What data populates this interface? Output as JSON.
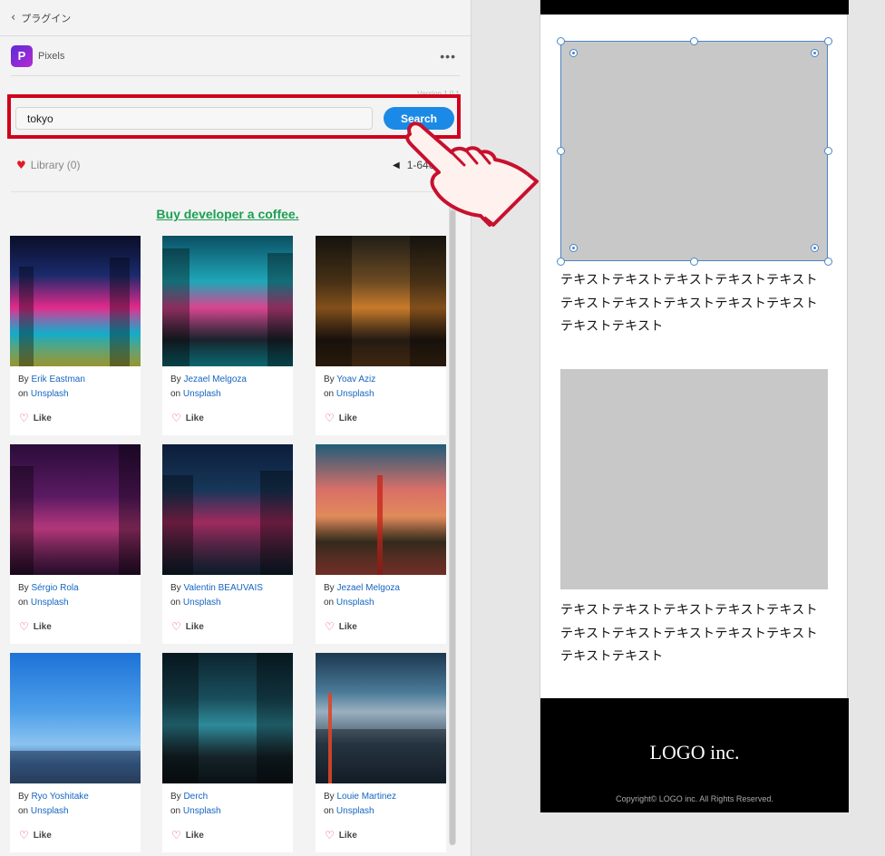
{
  "panel": {
    "breadcrumb": "プラグイン",
    "plugin_name": "Pixels",
    "plugin_logo_letter": "P",
    "version": "Version 1.0.1",
    "search": {
      "value": "tokyo",
      "button": "Search"
    },
    "library": "Library (0)",
    "pagination": "1-640",
    "coffee": "Buy developer a coffee.",
    "photos": [
      {
        "by": "By",
        "author": "Erik Eastman",
        "on": "on",
        "source": "Unsplash",
        "like": "Like"
      },
      {
        "by": "By",
        "author": "Jezael Melgoza",
        "on": "on",
        "source": "Unsplash",
        "like": "Like"
      },
      {
        "by": "By",
        "author": "Yoav Aziz",
        "on": "on",
        "source": "Unsplash",
        "like": "Like"
      },
      {
        "by": "By",
        "author": "Sérgio Rola",
        "on": "on",
        "source": "Unsplash",
        "like": "Like"
      },
      {
        "by": "By",
        "author": "Valentin BEAUVAIS",
        "on": "on",
        "source": "Unsplash",
        "like": "Like"
      },
      {
        "by": "By",
        "author": "Jezael Melgoza",
        "on": "on",
        "source": "Unsplash",
        "like": "Like"
      },
      {
        "by": "By",
        "author": "Ryo Yoshitake",
        "on": "on",
        "source": "Unsplash",
        "like": "Like"
      },
      {
        "by": "By",
        "author": "Derch",
        "on": "on",
        "source": "Unsplash",
        "like": "Like"
      },
      {
        "by": "By",
        "author": "Louie Martinez",
        "on": "on",
        "source": "Unsplash",
        "like": "Like"
      }
    ]
  },
  "artboard": {
    "text1_lines": [
      "テキストテキストテキストテキストテキスト",
      "テキストテキストテキストテキストテキスト",
      "テキストテキスト"
    ],
    "text2_lines": [
      "テキストテキストテキストテキストテキスト",
      "テキストテキストテキストテキストテキスト",
      "テキストテキスト"
    ],
    "footer_logo": "LOGO inc.",
    "copyright": "Copyright© LOGO inc. All Rights Reserved."
  },
  "colors": {
    "highlight": "#d0021b",
    "accent": "#1b8ae6",
    "coffee": "#1aa052",
    "link": "#1565c0",
    "selection": "#4a86c8"
  }
}
